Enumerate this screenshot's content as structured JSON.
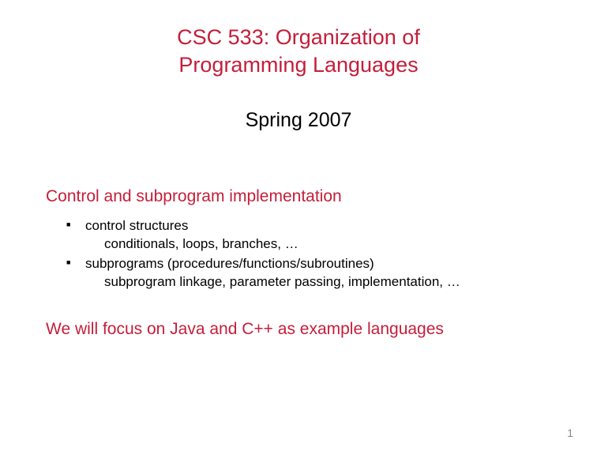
{
  "title_line1": "CSC 533: Organization of",
  "title_line2": "Programming Languages",
  "subtitle": "Spring 2007",
  "section_heading": "Control and subprogram implementation",
  "bullets": {
    "item1_main": "control structures",
    "item1_sub": "conditionals, loops, branches, …",
    "item2_main": "subprograms (procedures/functions/subroutines)",
    "item2_sub": "subprogram linkage, parameter passing, implementation, …"
  },
  "closing": "We will focus on Java and C++ as example languages",
  "page_number": "1"
}
